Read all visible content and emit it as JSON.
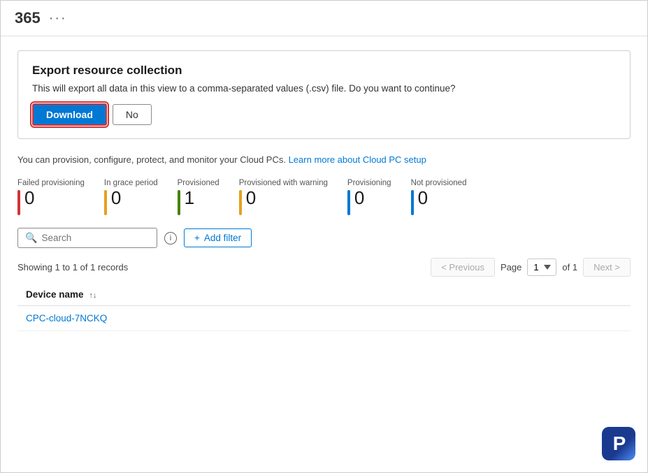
{
  "topbar": {
    "title": "365",
    "dots": "···"
  },
  "export_dialog": {
    "title": "Export resource collection",
    "description": "This will export all data in this view to a comma-separated values (.csv) file. Do you want to continue?",
    "download_label": "Download",
    "no_label": "No"
  },
  "info_strip": {
    "text": "You can provision, configure, protect, and monitor your Cloud PCs.",
    "link_text": "Learn more about Cloud PC setup",
    "link_href": "#"
  },
  "status_counters": [
    {
      "label": "Failed provisioning",
      "count": "0",
      "color": "#d13438"
    },
    {
      "label": "In grace period",
      "count": "0",
      "color": "#e6a020"
    },
    {
      "label": "Provisioned",
      "count": "1",
      "color": "#498205"
    },
    {
      "label": "Provisioned with warning",
      "count": "0",
      "color": "#e6a020"
    },
    {
      "label": "Provisioning",
      "count": "0",
      "color": "#0078d4"
    },
    {
      "label": "Not provisioned",
      "count": "0",
      "color": "#0078d4"
    }
  ],
  "search": {
    "placeholder": "Search"
  },
  "add_filter_label": "Add filter",
  "records_label": "Showing 1 to 1 of 1 records",
  "pagination": {
    "previous_label": "< Previous",
    "next_label": "Next >",
    "page_label": "Page",
    "current_page": "1",
    "of_label": "of 1",
    "page_options": [
      "1"
    ]
  },
  "table": {
    "columns": [
      {
        "label": "Device name",
        "sortable": true
      }
    ],
    "rows": [
      {
        "device_name": "CPC-cloud-7NCKQ"
      }
    ]
  }
}
